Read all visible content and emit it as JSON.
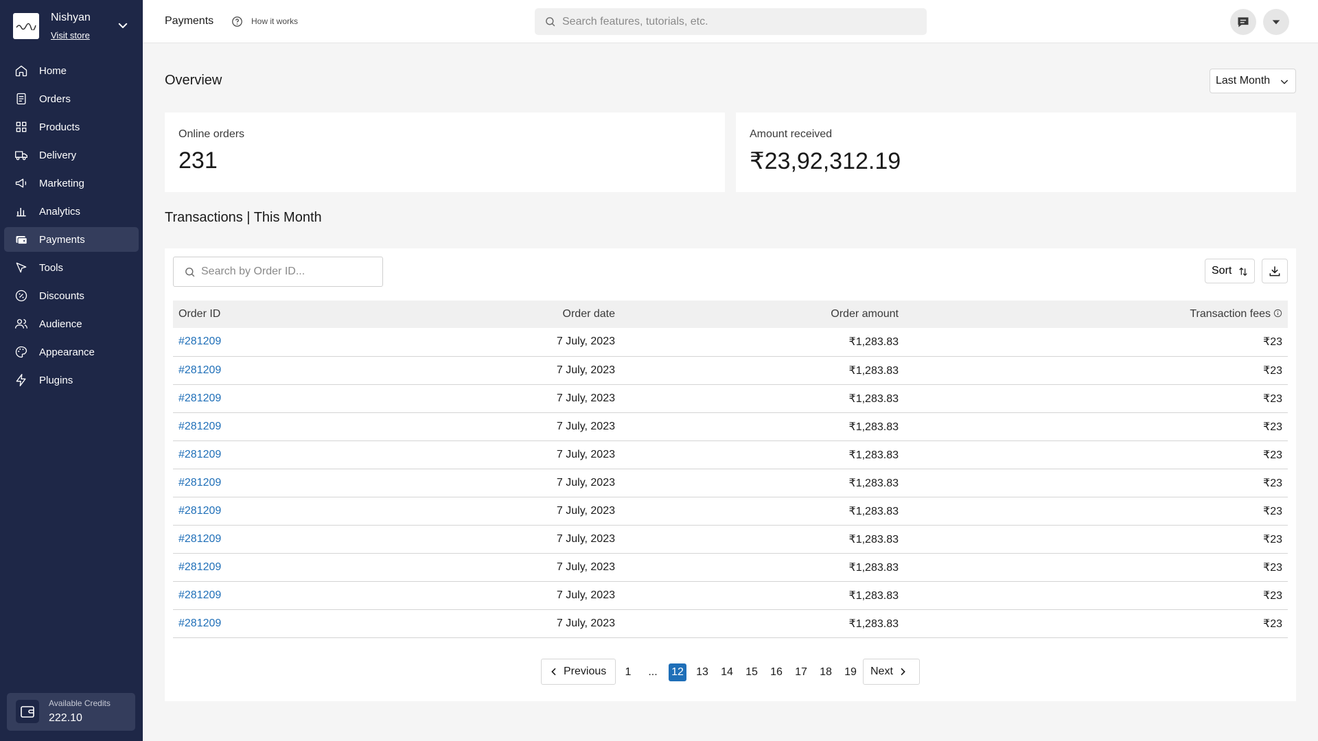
{
  "store": {
    "name": "Nishyan",
    "visit_label": "Visit store"
  },
  "sidebar": {
    "items": [
      {
        "label": "Home",
        "icon": "home-icon"
      },
      {
        "label": "Orders",
        "icon": "orders-icon"
      },
      {
        "label": "Products",
        "icon": "products-icon"
      },
      {
        "label": "Delivery",
        "icon": "truck-icon"
      },
      {
        "label": "Marketing",
        "icon": "megaphone-icon"
      },
      {
        "label": "Analytics",
        "icon": "bar-chart-icon"
      },
      {
        "label": "Payments",
        "icon": "wallet-icon",
        "active": true
      },
      {
        "label": "Tools",
        "icon": "cursor-icon"
      },
      {
        "label": "Discounts",
        "icon": "discount-icon"
      },
      {
        "label": "Audience",
        "icon": "users-icon"
      },
      {
        "label": "Appearance",
        "icon": "palette-icon"
      },
      {
        "label": "Plugins",
        "icon": "bolt-icon"
      }
    ],
    "credits": {
      "label": "Available Credits",
      "value": "222.10"
    }
  },
  "topbar": {
    "title": "Payments",
    "how_it_works": "How it works",
    "search_placeholder": "Search features, tutorials, etc."
  },
  "overview": {
    "title": "Overview",
    "period": "Last Month",
    "cards": [
      {
        "label": "Online orders",
        "value": "231"
      },
      {
        "label": "Amount received",
        "value": "₹23,92,312.19"
      }
    ]
  },
  "transactions": {
    "title": "Transactions | This Month",
    "search_placeholder": "Search by Order ID...",
    "sort_label": "Sort",
    "columns": [
      "Order ID",
      "Order date",
      "Order amount",
      "Transaction fees"
    ],
    "rows": [
      [
        "#281209",
        "7 July, 2023",
        "₹1,283.83",
        "₹23"
      ],
      [
        "#281209",
        "7 July, 2023",
        "₹1,283.83",
        "₹23"
      ],
      [
        "#281209",
        "7 July, 2023",
        "₹1,283.83",
        "₹23"
      ],
      [
        "#281209",
        "7 July, 2023",
        "₹1,283.83",
        "₹23"
      ],
      [
        "#281209",
        "7 July, 2023",
        "₹1,283.83",
        "₹23"
      ],
      [
        "#281209",
        "7 July, 2023",
        "₹1,283.83",
        "₹23"
      ],
      [
        "#281209",
        "7 July, 2023",
        "₹1,283.83",
        "₹23"
      ],
      [
        "#281209",
        "7 July, 2023",
        "₹1,283.83",
        "₹23"
      ],
      [
        "#281209",
        "7 July, 2023",
        "₹1,283.83",
        "₹23"
      ],
      [
        "#281209",
        "7 July, 2023",
        "₹1,283.83",
        "₹23"
      ],
      [
        "#281209",
        "7 July, 2023",
        "₹1,283.83",
        "₹23"
      ]
    ]
  },
  "pagination": {
    "previous": "Previous",
    "next": "Next",
    "pages": [
      "1",
      "...",
      "12",
      "13",
      "14",
      "15",
      "16",
      "17",
      "18",
      "19"
    ],
    "current": "12"
  },
  "colors": {
    "sidebar_bg": "#1e2747",
    "sidebar_active": "#343d5c",
    "link": "#1f6fb8",
    "accent": "#1f6fb8"
  }
}
